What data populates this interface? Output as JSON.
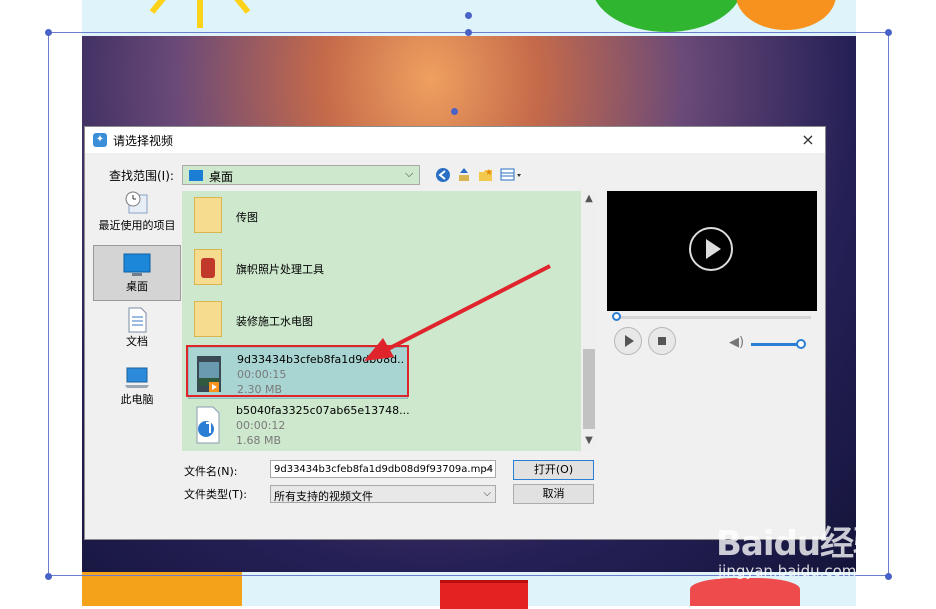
{
  "dialog": {
    "title": "请选择视频",
    "close": "×",
    "lookin_label": "查找范围(I):",
    "lookin_value": "桌面"
  },
  "places": [
    {
      "label": "最近使用的项目",
      "icon": "recent-items-icon"
    },
    {
      "label": "桌面",
      "icon": "desktop-icon"
    },
    {
      "label": "文档",
      "icon": "documents-icon"
    },
    {
      "label": "此电脑",
      "icon": "computer-icon"
    }
  ],
  "files": [
    {
      "name": "传图",
      "icon": "folder-icon"
    },
    {
      "name": "旗帜照片处理工具",
      "icon": "folder-app-icon"
    },
    {
      "name": "装修施工水电图",
      "icon": "folder-icon"
    },
    {
      "name": "9d33434b3cfeb8fa1d9db08d...",
      "duration": "00:00:15",
      "size": "2.30 MB",
      "icon": "video-file-icon",
      "selected": true
    },
    {
      "name": "b5040fa3325c07ab65e13748...",
      "duration": "00:00:12",
      "size": "1.68 MB",
      "icon": "audio-file-icon"
    }
  ],
  "filename": {
    "label": "文件名(N):",
    "value": "9d33434b3cfeb8fa1d9db08d9f93709a.mp4"
  },
  "filetype": {
    "label": "文件类型(T):",
    "value": "所有支持的视频文件"
  },
  "buttons": {
    "open": "打开(O)",
    "cancel": "取消"
  },
  "preview": {
    "progress": 0,
    "volume": 0.9
  },
  "watermark": {
    "main": "Baidu经验",
    "sub": "jingyan.baidu.com"
  },
  "colors": {
    "annotation": "#e0242c",
    "list_background": "#cde8cd",
    "selection": "#a8d4d2"
  }
}
